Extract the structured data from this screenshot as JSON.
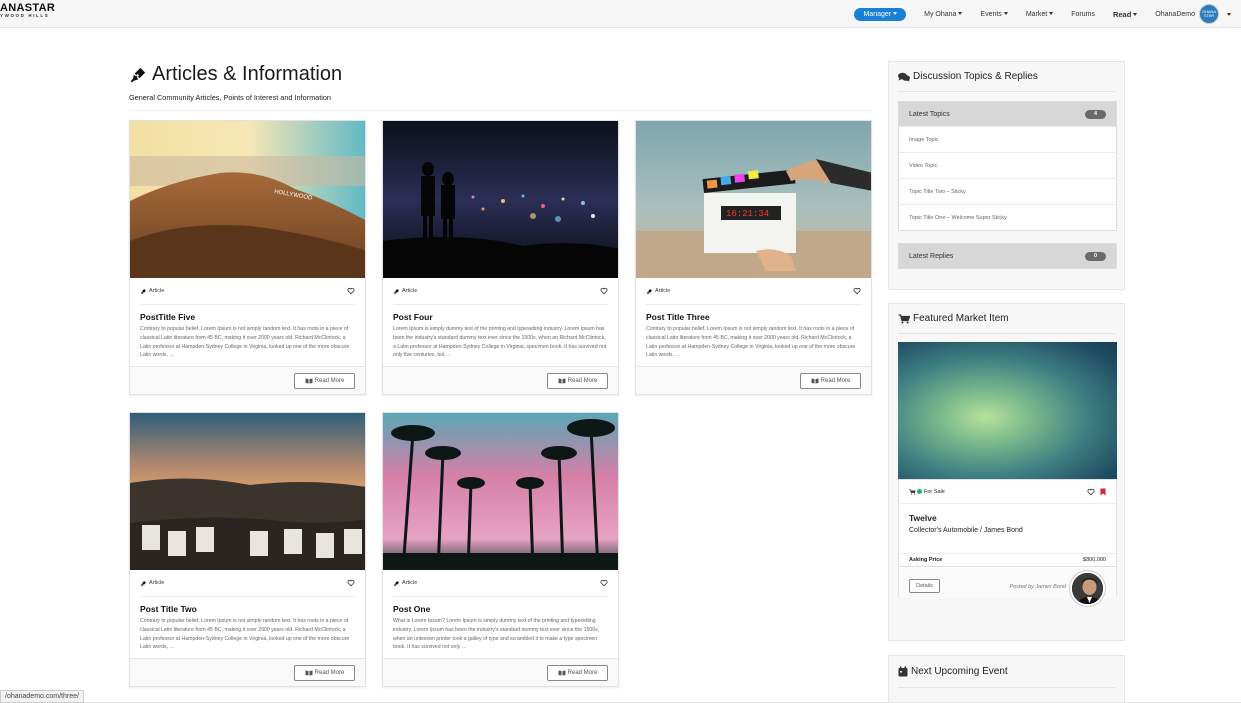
{
  "navbar": {
    "brand_main": "ANASTAR",
    "brand_sub": "YWOOD HILLS",
    "manager": "Manager",
    "my_ohana": "My Ohana",
    "events": "Events",
    "market": "Market",
    "forums": "Forums",
    "read": "Read",
    "user": "OhanaDemo",
    "avatar_text": "OHANA STAR"
  },
  "header": {
    "title": "Articles & Information",
    "subtitle": "General Community Articles, Points of Interest and Information"
  },
  "cards": [
    {
      "type": "Article",
      "title": "PostTitle Five",
      "text": "Contrary to popular belief, Lorem Ipsum is not simply random text. It has roots in a piece of classical Latin literature from 45 BC, making it over 2000 years old. Richard McClintock, a Latin professor at Hampden-Sydney College in Virginia, looked up one of the more obscure Latin words, …",
      "button": "Read More"
    },
    {
      "type": "Article",
      "title": "Post Four",
      "text": "Lorem Ipsum is simply dummy text of the printing and typesetting industry. Lorem Ipsum has been the industry's standard dummy text ever since the 1500s, when an Richard McClintock, a Latin professor at Hampden-Sydney College in Virginia, specimen book. It has survived not only five centuries, but …",
      "button": "Read More"
    },
    {
      "type": "Article",
      "title": "Post Title Three",
      "text": "Contrary to popular belief, Lorem Ipsum is not simply random text. It has roots in a piece of classical Latin literature from 45 BC, making it over 2000 years old. Richard McClintock, a Latin professor at Hampden-Sydney College in Virginia, looked up one of the more obscure Latin words, …",
      "button": "Read More"
    },
    {
      "type": "Article",
      "title": "Post Title Two",
      "text": "Contrary to popular belief, Lorem Ipsum is not simply random text. It has roots in a piece of classical Latin literature from 45 BC, making it over 2000 years old. Richard McClintock, a Latin professor at Hampden-Sydney College in Virginia, looked up one of the more obscure Latin words, …",
      "button": "Read More"
    },
    {
      "type": "Article",
      "title": "Post One",
      "text": "What is Lorem Ipsum? Lorem Ipsum is simply dummy text of the printing and typesetting industry. Lorem Ipsum has been the industry's standard dummy text ever since the 1500s, when an unknown printer took a galley of type and scrambled it to make a type specimen book. It has survived not only …",
      "button": "Read More"
    }
  ],
  "sidebar": {
    "discussion": {
      "title": "Discussion Topics & Replies",
      "latest_topics": "Latest Topics",
      "topics_count": "4",
      "topics": [
        "Image Topic",
        "Video Topic",
        "Topic Title Two – Sticky",
        "Topic Title One – Welcome Super Sticky"
      ],
      "latest_replies": "Latest Replies",
      "replies_count": "0"
    },
    "market": {
      "title": "Featured Market Item",
      "status": "For Sale",
      "item_title": "Twelve",
      "item_subtitle": "Collector's Automobile / James Bond",
      "price_label": "Asking Price",
      "price": "$800,000",
      "details": "Details",
      "posted_by": "Posted by James Bond"
    },
    "event": {
      "title": "Next Upcoming Event"
    }
  },
  "status_url": "/ohanademo.com/three/"
}
